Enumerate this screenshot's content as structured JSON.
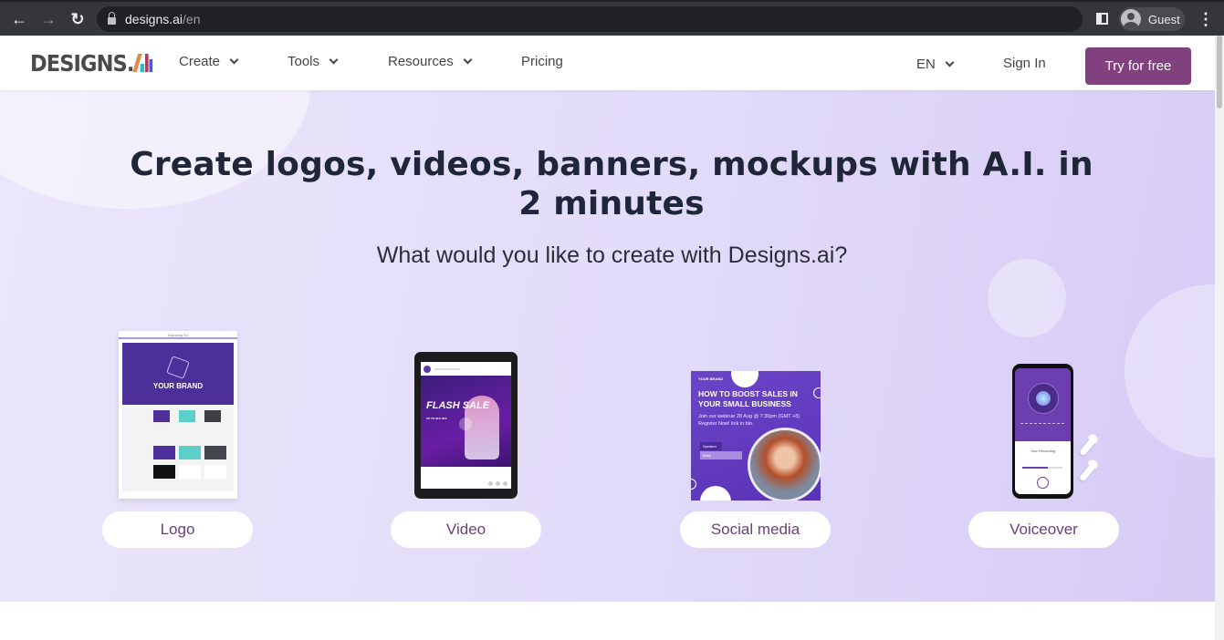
{
  "browser": {
    "url_host": "designs.ai",
    "url_path": "/en",
    "profile_label": "Guest",
    "icons": [
      "back-arrow-icon",
      "forward-arrow-icon",
      "reload-icon",
      "lock-icon",
      "side-panel-icon",
      "avatar-icon",
      "kebab-menu-icon"
    ]
  },
  "header": {
    "logo_text": "DESIGNS.",
    "nav": [
      {
        "label": "Create",
        "has_dropdown": true
      },
      {
        "label": "Tools",
        "has_dropdown": true
      },
      {
        "label": "Resources",
        "has_dropdown": true
      },
      {
        "label": "Pricing",
        "has_dropdown": false
      }
    ],
    "language": "EN",
    "sign_in": "Sign In",
    "cta": "Try for free",
    "cta_color": "#81417e"
  },
  "hero": {
    "headline": "Create logos, videos, banners, mockups with A.I. in 2 minutes",
    "subtitle": "What would you like to create with Designs.ai?",
    "categories": [
      {
        "label": "Logo",
        "preview": {
          "title": "Branding Kit",
          "brand": "YOUR BRAND"
        }
      },
      {
        "label": "Video",
        "preview": {
          "title": "FLASH SALE",
          "sub": "UP TO 30% OFF"
        }
      },
      {
        "label": "Social media",
        "preview": {
          "brand": "YOUR BRAND",
          "title": "HOW TO BOOST SALES IN YOUR SMALL BUSINESS",
          "text": "Join our webinar 28 Aug @ 7:30pm (GMT +8) Register Now! link in bio.",
          "speaker_tag": "Speaker",
          "speaker_name": "Abby"
        }
      },
      {
        "label": "Voiceover",
        "preview": {
          "title": "Your Recording"
        }
      }
    ]
  }
}
